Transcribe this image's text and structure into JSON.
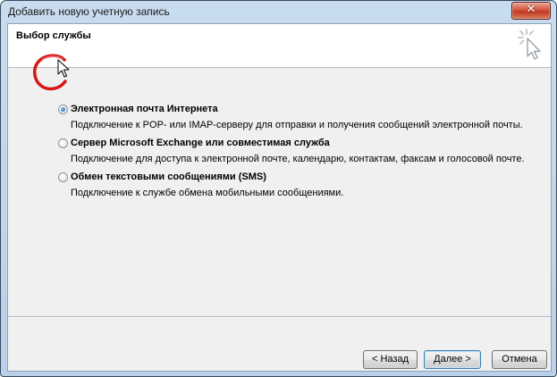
{
  "window": {
    "title": "Добавить новую учетную запись",
    "close_glyph": "✕"
  },
  "header": {
    "title": "Выбор службы",
    "icon": "wizard-cursor-icon"
  },
  "options": [
    {
      "label": "Электронная почта Интернета",
      "description": "Подключение к POP- или IMAP-серверу для отправки и получения сообщений электронной почты.",
      "selected": true
    },
    {
      "label": "Сервер Microsoft Exchange или совместимая служба",
      "description": "Подключение для доступа к электронной почте, календарю, контактам, факсам и голосовой почте.",
      "selected": false
    },
    {
      "label": "Обмен текстовыми сообщениями (SMS)",
      "description": "Подключение к службе обмена мобильными сообщениями.",
      "selected": false
    }
  ],
  "buttons": {
    "back": "< Назад",
    "next": "Далее >",
    "cancel": "Отмена"
  },
  "colors": {
    "highlight_ring": "#d81818",
    "title_bar": "#c3d8ee",
    "close_button": "#c9452c"
  }
}
